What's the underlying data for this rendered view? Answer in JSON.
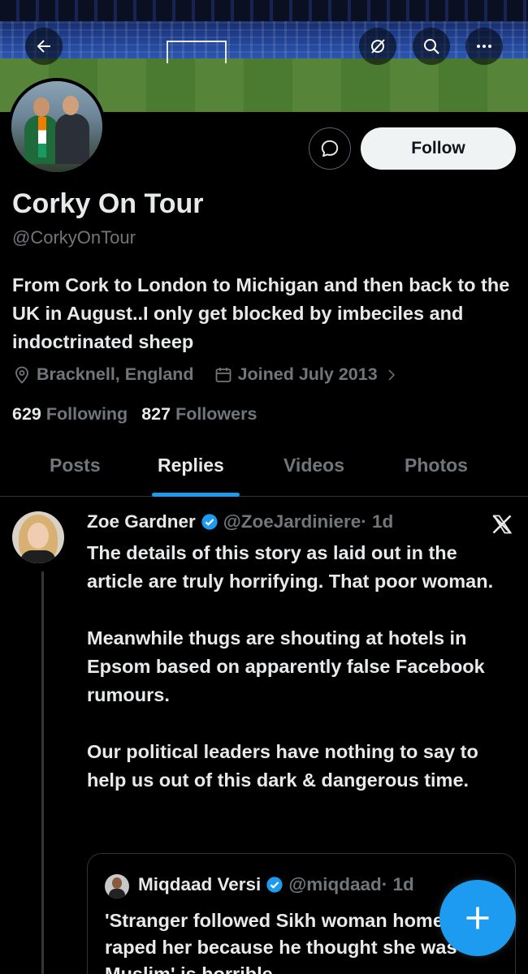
{
  "profile": {
    "display_name": "Corky On Tour",
    "handle": "@CorkyOnTour",
    "bio": "From Cork to London to Michigan and then back to the UK in August..I only get blocked by imbeciles and indoctrinated sheep",
    "location": "Bracknell, England",
    "joined": "Joined July 2013",
    "following_count": "629",
    "following_label": "Following",
    "followers_count": "827",
    "followers_label": "Followers",
    "follow_button": "Follow"
  },
  "header": {
    "icons": [
      "back-arrow-icon",
      "grok-icon",
      "search-icon",
      "more-icon"
    ]
  },
  "tabs": [
    {
      "label": "Posts",
      "active": false
    },
    {
      "label": "Replies",
      "active": true
    },
    {
      "label": "Videos",
      "active": false
    },
    {
      "label": "Photos",
      "active": false
    }
  ],
  "post": {
    "author_name": "Zoe Gardner",
    "author_handle": "@ZoeJardiniere",
    "time": "· 1d",
    "paragraphs": [
      "The details of this story as laid out in the article are truly horrifying. That poor woman.",
      "Meanwhile thugs are shouting at hotels in Epsom based on apparently false Facebook rumours.",
      "Our political leaders have nothing to say to help us out of this dark & dangerous time."
    ],
    "quote": {
      "author_name": "Miqdaad Versi",
      "author_handle": "@miqdaad",
      "time": "· 1d",
      "text": "'Stranger followed Sikh woman home then raped her because he thought she was a Muslim' is horrible"
    }
  },
  "colors": {
    "accent": "#1d9bf0",
    "background": "#000000",
    "muted": "#71767b",
    "text": "#e7e9ea"
  }
}
